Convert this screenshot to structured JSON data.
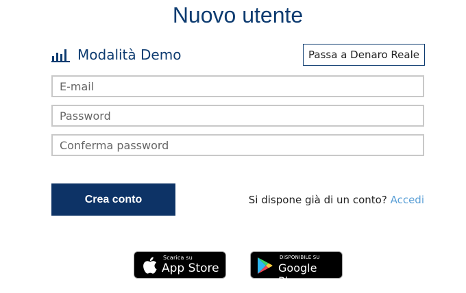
{
  "page": {
    "title": "Nuovo utente"
  },
  "mode": {
    "icon": "bar-chart-icon",
    "label": "Modalità Demo",
    "switch_label": "Passa a Denaro Reale"
  },
  "form": {
    "email_placeholder": "E-mail",
    "password_placeholder": "Password",
    "confirm_placeholder": "Conferma password",
    "create_label": "Crea conto",
    "login_prompt": "Si dispone già di un conto?",
    "login_link": "Accedi"
  },
  "stores": {
    "apple_small": "Scarica su",
    "apple_big": "App Store",
    "google_small": "DISPONIBILE SU",
    "google_big": "Google Play"
  },
  "colors": {
    "brand": "#0d3b70",
    "button": "#0d3366",
    "link": "#5a9fd6"
  }
}
